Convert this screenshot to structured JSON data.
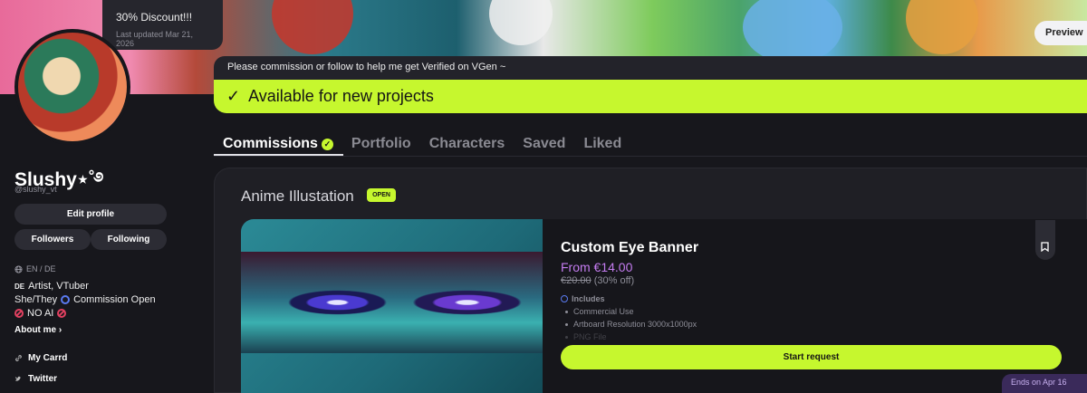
{
  "banner": {
    "discount_title": "30% Discount!!!",
    "last_updated": "Last updated Mar 21, 2026",
    "preview_label": "Preview"
  },
  "profile": {
    "display_name": "Slushy⋆˚࿔",
    "handle": "@slushy_vt",
    "edit_profile_label": "Edit profile",
    "followers_label": "Followers",
    "following_label": "Following",
    "languages": "EN / DE",
    "bio_line1_tag": "DE",
    "bio_line1": "Artist, VTuber",
    "bio_line2": "She/They",
    "bio_line2_rest": "Commission Open",
    "bio_line3": "NO AI",
    "about_label": "About me",
    "links": [
      {
        "label": "My Carrd",
        "icon": "link-icon"
      },
      {
        "label": "Twitter",
        "icon": "twitter-icon"
      }
    ]
  },
  "notice": {
    "text": "Please commission or follow to help me get Verified on VGen ~",
    "available_text": "Available for new projects"
  },
  "tabs": [
    {
      "label": "Commissions",
      "active": true
    },
    {
      "label": "Portfolio",
      "active": false
    },
    {
      "label": "Characters",
      "active": false
    },
    {
      "label": "Saved",
      "active": false
    },
    {
      "label": "Liked",
      "active": false
    }
  ],
  "section": {
    "title": "Anime Illustation",
    "status_badge": "OPEN"
  },
  "card": {
    "title": "Custom Eye Banner",
    "price": "From €14.00",
    "old_price": "€20.00",
    "discount_note": "(30% off)",
    "includes_label": "Includes",
    "includes": [
      "Commercial Use",
      "Artboard Resolution 3000x1000px",
      "PNG File"
    ],
    "start_label": "Start request",
    "ends_label": "Ends on Apr 16"
  },
  "colors": {
    "accent_lime": "#c6f72e",
    "price_purple": "#c47cf0",
    "background": "#17171c"
  }
}
